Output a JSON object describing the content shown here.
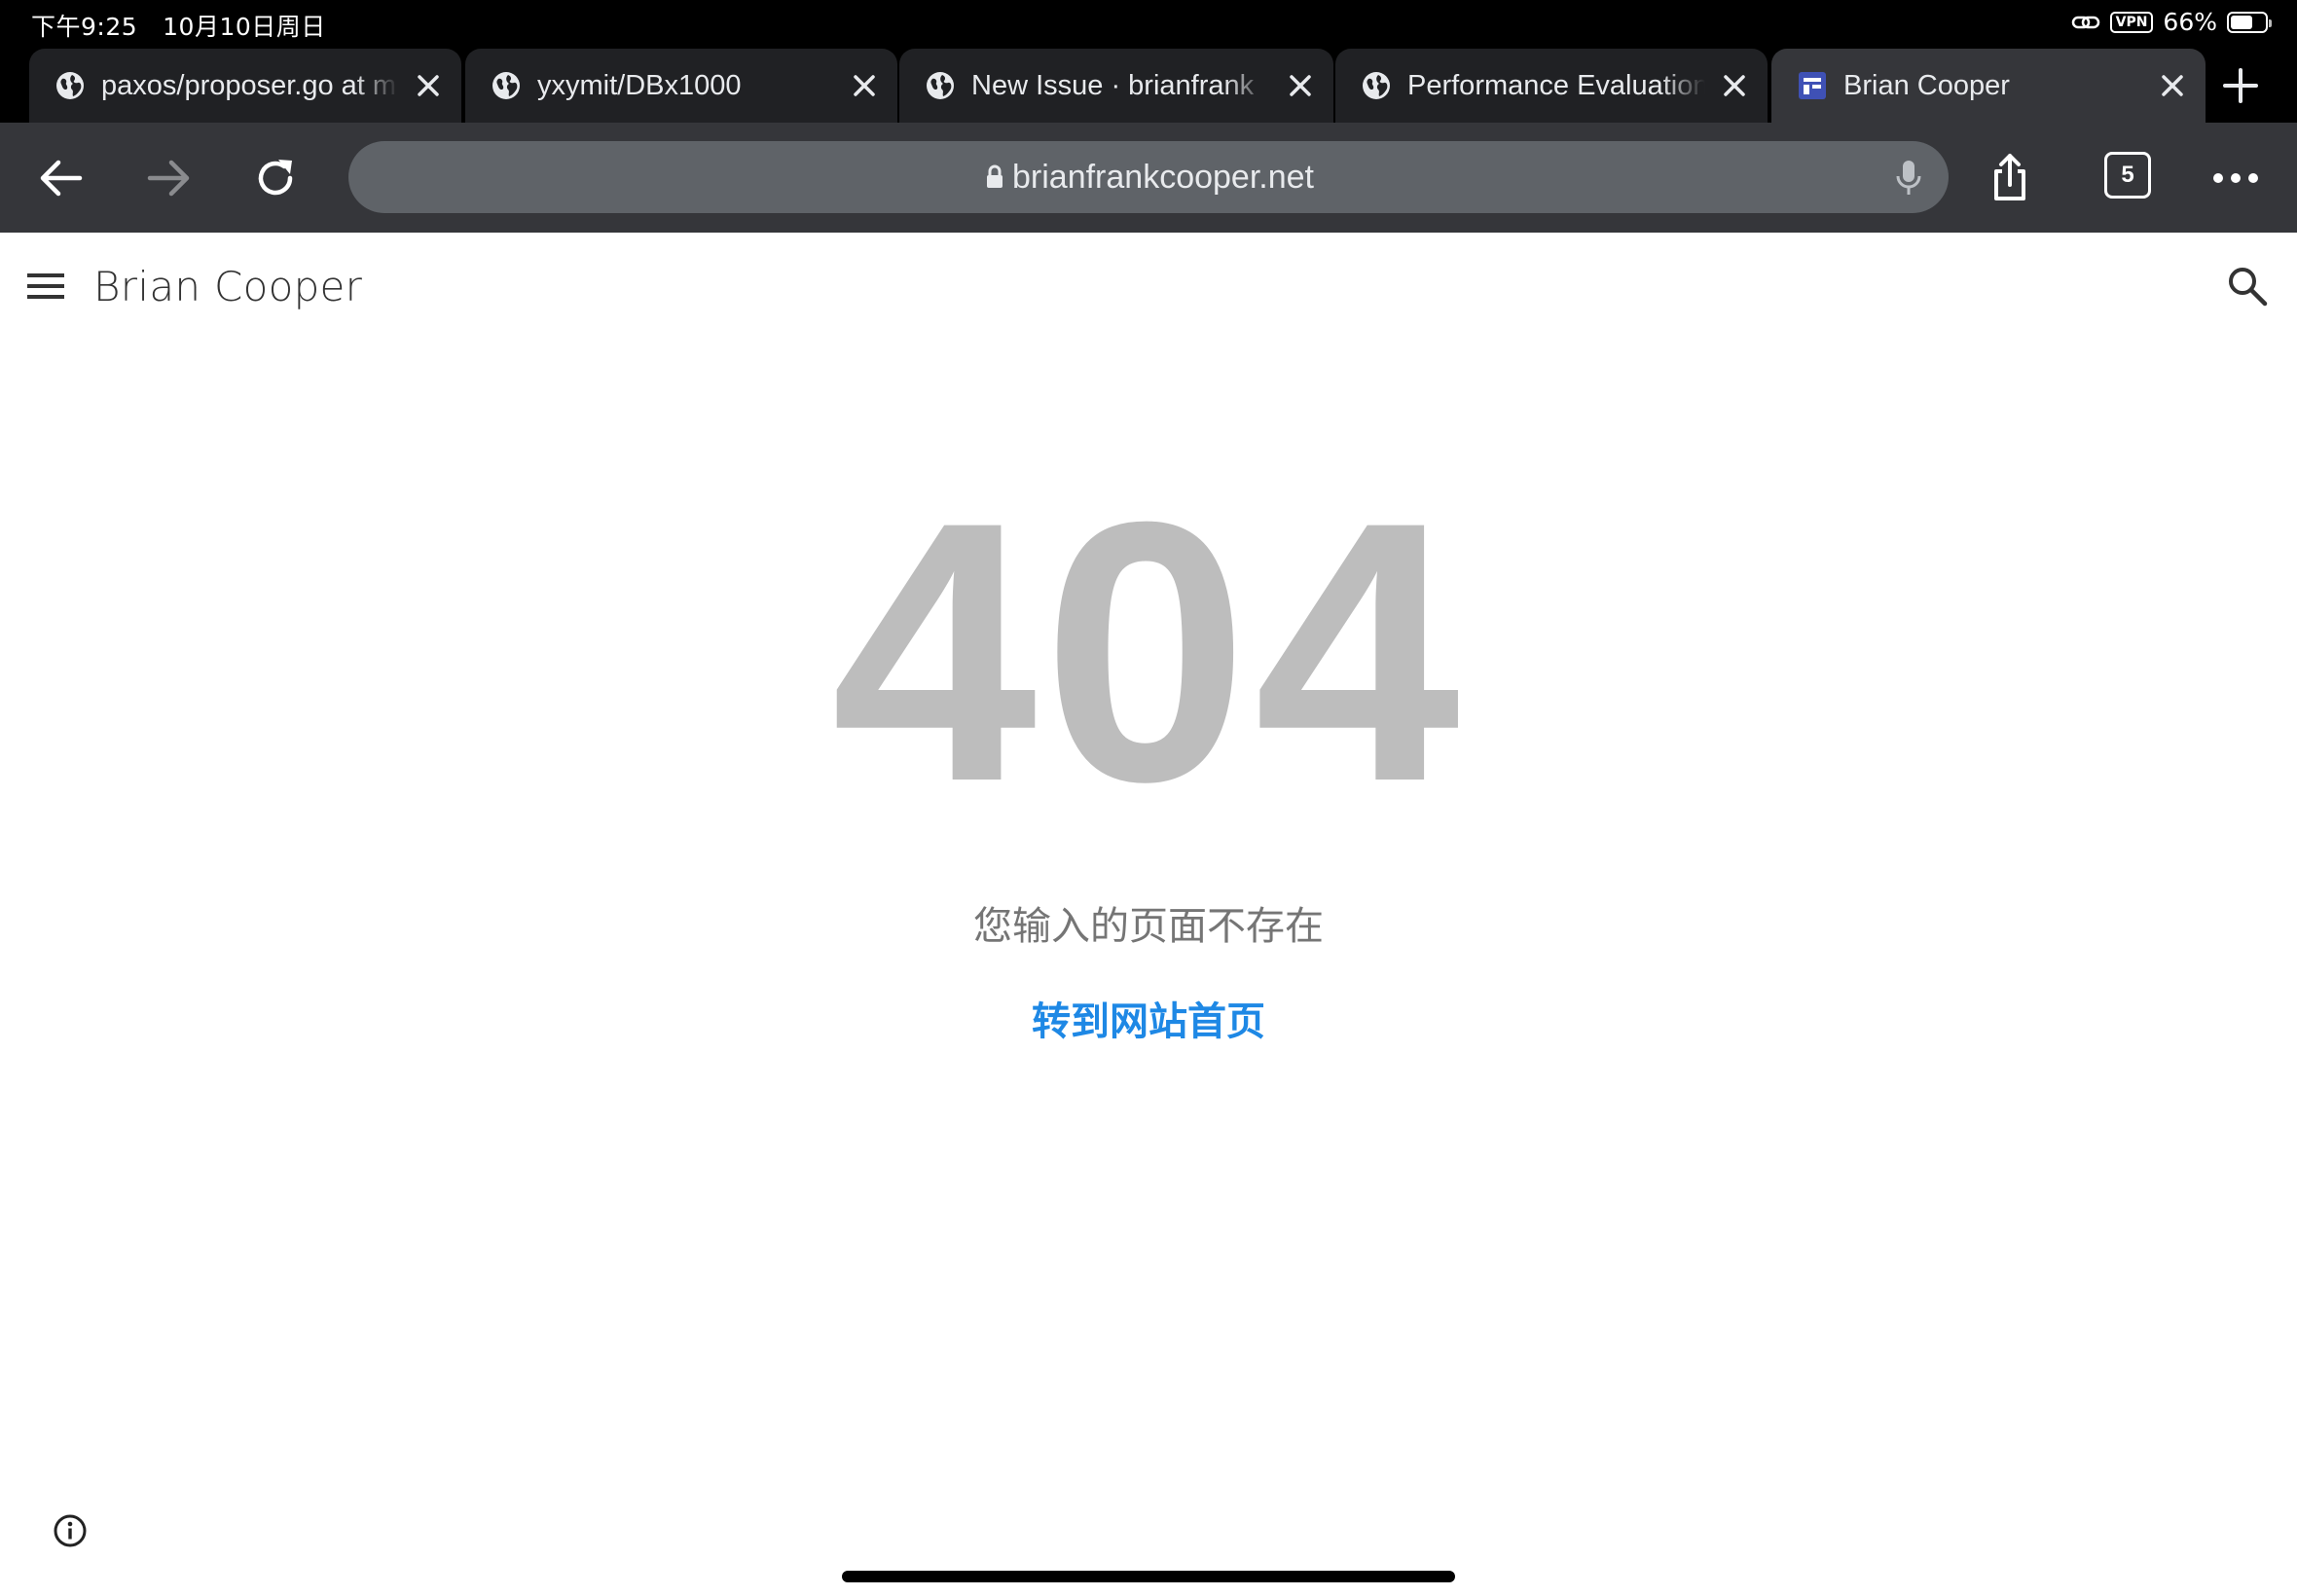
{
  "status_bar": {
    "time": "下午9:25",
    "date": "10月10日周日",
    "vpn_label": "VPN",
    "battery_percent": "66%",
    "battery_level": 0.66
  },
  "tabs": [
    {
      "title": "paxos/proposer.go at m",
      "favicon": "globe-icon",
      "active": false
    },
    {
      "title": "yxymit/DBx1000",
      "favicon": "globe-icon",
      "active": false
    },
    {
      "title": "New Issue · brianfrank",
      "favicon": "globe-icon",
      "active": false
    },
    {
      "title": "Performance Evaluation",
      "favicon": "globe-icon",
      "active": false
    },
    {
      "title": "Brian Cooper",
      "favicon": "site-logo-icon",
      "active": true
    }
  ],
  "toolbar": {
    "url": "brianfrankcooper.net",
    "tab_count": "5"
  },
  "site": {
    "title": "Brian Cooper"
  },
  "error": {
    "code": "404",
    "message": "您输入的页面不存在",
    "home_link": "转到网站首页"
  },
  "colors": {
    "status_bg": "#000000",
    "tab_bg": "#202124",
    "active_tab_bg": "#35363a",
    "omnibox_bg": "#5f6368",
    "error_code": "#bdbdbd",
    "link": "#1e88e5"
  }
}
